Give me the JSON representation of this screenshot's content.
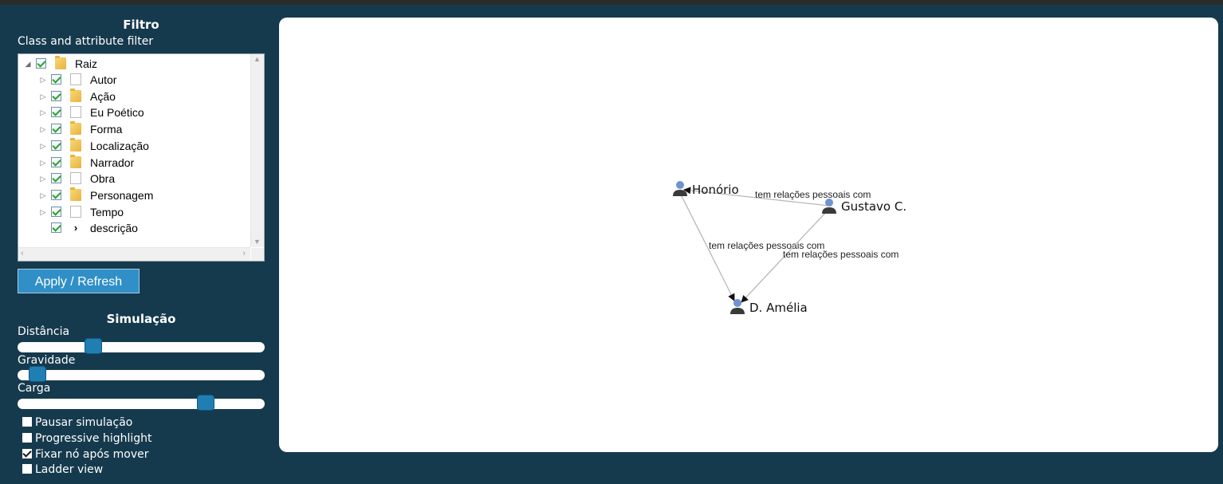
{
  "filter": {
    "title": "Filtro",
    "subtitle": "Class and attribute filter",
    "tree": [
      {
        "label": "Raiz",
        "icon": "folder-icon",
        "expanded": true,
        "checked": true
      },
      {
        "label": "Autor",
        "icon": "file-icon",
        "checked": true
      },
      {
        "label": "Ação",
        "icon": "folder-icon",
        "checked": true
      },
      {
        "label": "Eu Poético",
        "icon": "file-icon",
        "checked": true
      },
      {
        "label": "Forma",
        "icon": "folder-icon",
        "checked": true
      },
      {
        "label": "Localização",
        "icon": "folder-icon",
        "checked": true
      },
      {
        "label": "Narrador",
        "icon": "folder-icon",
        "checked": true
      },
      {
        "label": "Obra",
        "icon": "file-icon",
        "checked": true
      },
      {
        "label": "Personagem",
        "icon": "folder-icon",
        "checked": true
      },
      {
        "label": "Tempo",
        "icon": "file-icon",
        "checked": true
      },
      {
        "label": "descrição",
        "icon": "chevron-right-icon",
        "checked": true
      }
    ],
    "apply_label": "Apply / Refresh"
  },
  "simulation": {
    "title": "Simulação",
    "sliders": [
      {
        "label": "Distância",
        "value": 0.29
      },
      {
        "label": "Gravidade",
        "value": 0.05
      },
      {
        "label": "Carga",
        "value": 0.78
      }
    ],
    "options": [
      {
        "label": "Pausar simulação",
        "checked": false
      },
      {
        "label": "Progressive highlight",
        "checked": false
      },
      {
        "label": "Fixar nó após mover",
        "checked": true
      },
      {
        "label": "Ladder view",
        "checked": false
      }
    ]
  },
  "graph": {
    "nodes": [
      {
        "id": "honorio",
        "label": "Honório"
      },
      {
        "id": "gustavo",
        "label": "Gustavo C."
      },
      {
        "id": "amelia",
        "label": "D. Amélia"
      }
    ],
    "edges": [
      {
        "from": "gustavo",
        "to": "honorio",
        "label": "tem relações pessoais com"
      },
      {
        "from": "honorio",
        "to": "amelia",
        "label": "tem relações pessoais com"
      },
      {
        "from": "gustavo",
        "to": "amelia",
        "label": "tem relações pessoais com"
      }
    ],
    "colors": {
      "node": "#6f93d0",
      "edge": "#b8b8b8",
      "arrow": "#111111"
    }
  }
}
